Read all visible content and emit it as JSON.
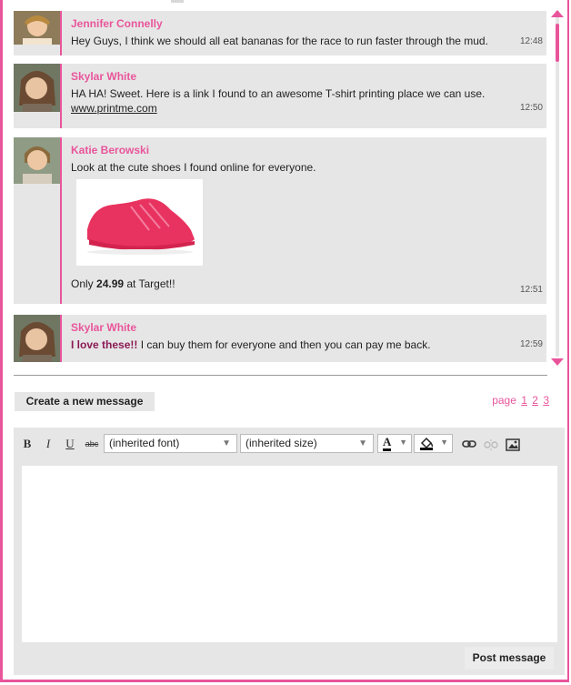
{
  "messages": [
    {
      "name": "Jennifer Connelly",
      "text": "Hey Guys, I think we should all eat bananas for the race to run faster through the mud.",
      "time": "12:48"
    },
    {
      "name": "Skylar White",
      "text": "HA HA! Sweet. Here is a link I found to an awesome T-shirt printing place we can use.",
      "link": "www.printme.com",
      "time": "12:50"
    },
    {
      "name": "Katie Berowski",
      "text": "Look at the cute shoes I found online for everyone.",
      "caption_pre": "Only ",
      "caption_bold": "24.99",
      "caption_post": " at Target!!",
      "time": "12:51"
    },
    {
      "name": "Skylar White",
      "text_bold": "I love these!!",
      "text": " I can buy them for everyone and then you can pay me back.",
      "time": "12:59"
    }
  ],
  "actions": {
    "create_new_message": "Create a new message",
    "post_message": "Post message"
  },
  "pager": {
    "label": "page",
    "pages": [
      "1",
      "2",
      "3"
    ]
  },
  "toolbar": {
    "bold": "B",
    "italic": "I",
    "underline": "U",
    "strike": "abc",
    "font_select": "(inherited font)",
    "size_select": "(inherited size)",
    "text_color": "A"
  },
  "colors": {
    "accent": "#e9559b",
    "panel": "#e6e6e6",
    "shoe": "#e8325f"
  }
}
